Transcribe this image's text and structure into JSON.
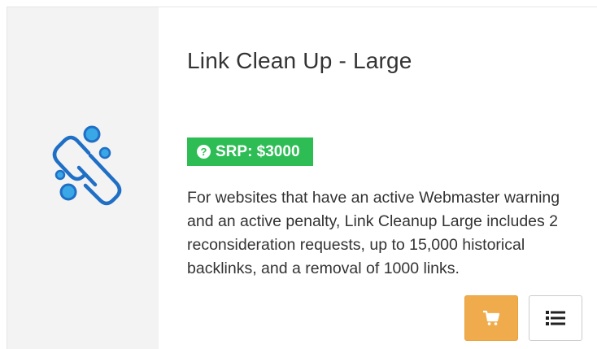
{
  "product": {
    "title": "Link Clean Up - Large",
    "icon": "broken-chain-link-icon",
    "srp_label": "SRP: $3000",
    "description": "For websites that have an active Webmaster warning and an active penalty, Link Cleanup Large includes 2 reconsideration requests, up to 15,000 historical backlinks, and a removal of 1000 links."
  },
  "actions": {
    "cart_icon": "shopping-cart-icon",
    "details_icon": "list-icon"
  },
  "colors": {
    "accent_blue": "#1f6fc5",
    "bubble_blue": "#3aa7e6",
    "srp_green": "#2ebd55",
    "cart_orange": "#f0ac4c",
    "panel_gray": "#f3f3f4",
    "text": "#333333"
  }
}
